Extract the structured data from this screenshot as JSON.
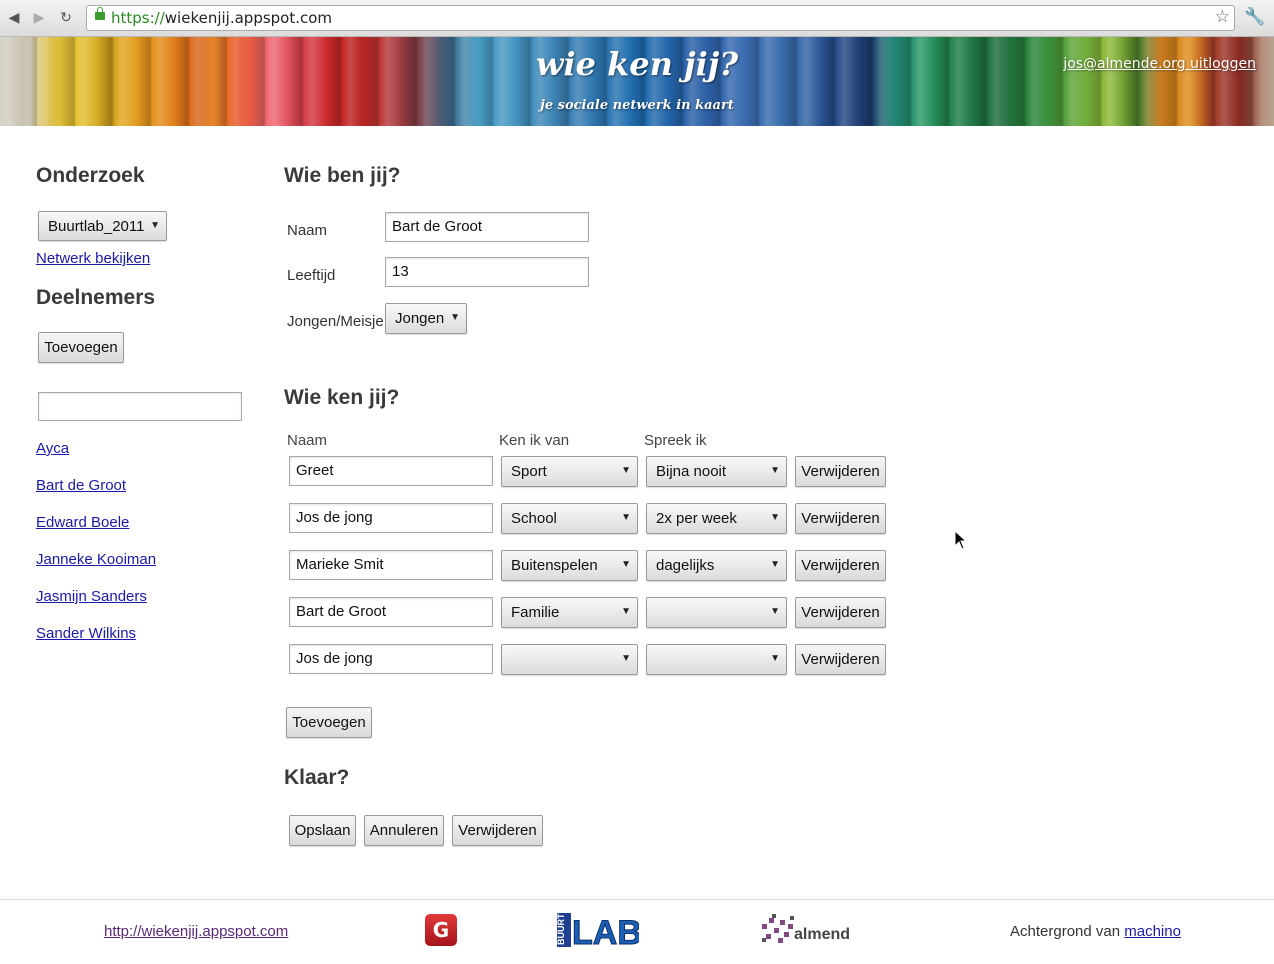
{
  "browser": {
    "back_icon": "back-arrow-icon",
    "forward_icon": "forward-arrow-icon",
    "reload_icon": "reload-icon",
    "url_scheme": "https://",
    "url_host": "wiekenjij.appspot.com",
    "bookmark_icon": "star-icon",
    "menu_icon": "wrench-icon"
  },
  "header": {
    "title": "wie ken jij?",
    "subtitle": "je sociale netwerk in kaart",
    "user_email": "jos@almende.org",
    "logout_label": "uitloggen"
  },
  "sidebar": {
    "onderzoek_heading": "Onderzoek",
    "onderzoek_selected": "Buurtlab_2011",
    "network_link": "Netwerk bekijken",
    "deelnemers_heading": "Deelnemers",
    "add_button": "Toevoegen",
    "search_value": "",
    "participants": [
      "Ayca",
      "Bart de Groot",
      "Edward Boele",
      "Janneke Kooiman",
      "Jasmijn Sanders",
      "Sander Wilkins"
    ]
  },
  "profile": {
    "heading": "Wie ben jij?",
    "name_label": "Naam",
    "name_value": "Bart de Groot",
    "age_label": "Leeftijd",
    "age_value": "13",
    "gender_label": "Jongen/Meisje",
    "gender_value": "Jongen"
  },
  "contacts": {
    "heading": "Wie ken jij?",
    "col_name": "Naam",
    "col_known_from": "Ken ik van",
    "col_speak": "Spreek ik",
    "rows": [
      {
        "name": "Greet",
        "known_from": "Sport",
        "speak": "Bijna nooit",
        "remove": "Verwijderen"
      },
      {
        "name": "Jos de jong",
        "known_from": "School",
        "speak": "2x per week",
        "remove": "Verwijderen"
      },
      {
        "name": "Marieke Smit",
        "known_from": "Buitenspelen",
        "speak": "dagelijks",
        "remove": "Verwijderen"
      },
      {
        "name": "Bart de Groot",
        "known_from": "Familie",
        "speak": "",
        "remove": "Verwijderen"
      },
      {
        "name": "Jos de jong",
        "known_from": "",
        "speak": "",
        "remove": "Verwijderen"
      }
    ],
    "add_button": "Toevoegen"
  },
  "finish": {
    "heading": "Klaar?",
    "save": "Opslaan",
    "cancel": "Annuleren",
    "delete": "Verwijderen"
  },
  "footer": {
    "site_link": "http://wiekenjij.appspot.com",
    "logo1_letter": "G",
    "logo2_text": "BUURT LAB",
    "logo3_text": "almende",
    "background_credit": "Achtergrond van",
    "credit_link": "machino"
  }
}
